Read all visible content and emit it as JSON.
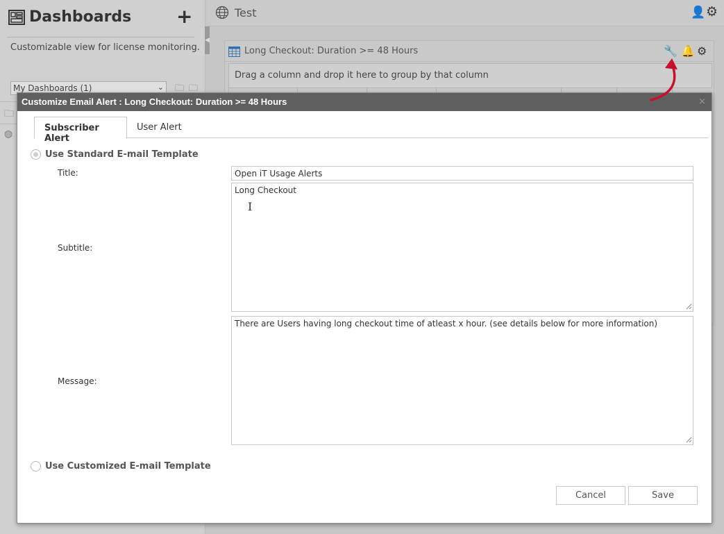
{
  "sidebar": {
    "title": "Dashboards",
    "add_label": "+",
    "description": "Customizable view for license monitoring.",
    "dashboard_select": "My Dashboards (1)"
  },
  "header": {
    "dashboard_name": "Test"
  },
  "widget": {
    "title": "Long Checkout: Duration >= 48 Hours",
    "group_hint": "Drag a column and drop it here to group by that column"
  },
  "modal": {
    "title": "Customize Email Alert : Long Checkout: Duration >= 48 Hours",
    "close_label": "×",
    "tabs": [
      {
        "label": "Subscriber Alert",
        "active": true
      },
      {
        "label": "User Alert",
        "active": false
      }
    ],
    "standard_template_label": "Use Standard E-mail Template",
    "customized_template_label": "Use Customized E-mail Template",
    "fields": {
      "title_label": "Title:",
      "title_value": "Open iT Usage Alerts",
      "subtitle_label": "Subtitle:",
      "subtitle_value": "Long Checkout",
      "message_label": "Message:",
      "message_value": "There are Users having long checkout time of atleast x hour. (see details below for more information)"
    },
    "buttons": {
      "cancel": "Cancel",
      "save": "Save"
    }
  },
  "colors": {
    "modal_titlebar": "#5f5f5f",
    "user_icon": "#1e63a8",
    "annotation_arrow": "#c8102e"
  }
}
